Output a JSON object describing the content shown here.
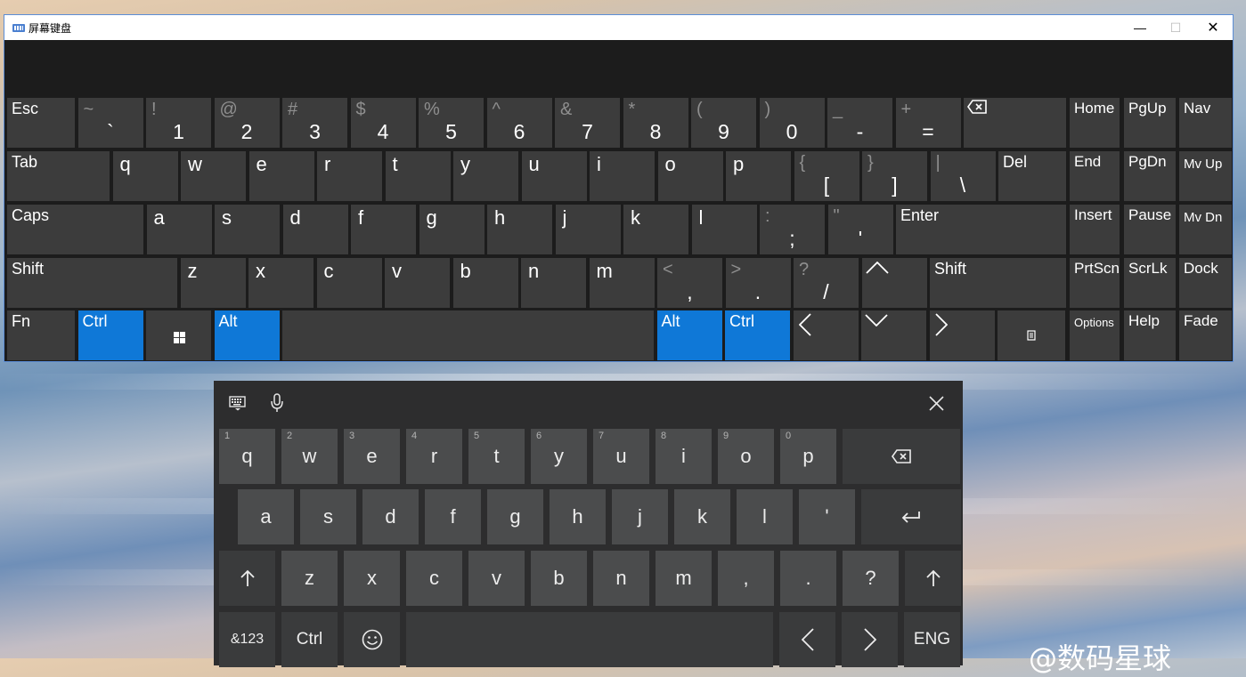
{
  "window": {
    "title": "屏幕键盘"
  },
  "osk": {
    "row1": [
      {
        "label": "Esc"
      },
      {
        "sec": "~",
        "pri": "`"
      },
      {
        "sec": "!",
        "pri": "1"
      },
      {
        "sec": "@",
        "pri": "2"
      },
      {
        "sec": "#",
        "pri": "3"
      },
      {
        "sec": "$",
        "pri": "4"
      },
      {
        "sec": "%",
        "pri": "5"
      },
      {
        "sec": "^",
        "pri": "6"
      },
      {
        "sec": "&",
        "pri": "7"
      },
      {
        "sec": "*",
        "pri": "8"
      },
      {
        "sec": "(",
        "pri": "9"
      },
      {
        "sec": ")",
        "pri": "0"
      },
      {
        "sec": "_",
        "pri": "-"
      },
      {
        "sec": "+",
        "pri": "="
      },
      {
        "icon": "backspace-icon"
      }
    ],
    "row2": [
      {
        "label": "Tab"
      },
      {
        "label": "q"
      },
      {
        "label": "w"
      },
      {
        "label": "e"
      },
      {
        "label": "r"
      },
      {
        "label": "t"
      },
      {
        "label": "y"
      },
      {
        "label": "u"
      },
      {
        "label": "i"
      },
      {
        "label": "o"
      },
      {
        "label": "p"
      },
      {
        "sec": "{",
        "pri": "["
      },
      {
        "sec": "}",
        "pri": "]"
      },
      {
        "sec": "|",
        "pri": "\\"
      },
      {
        "label": "Del"
      }
    ],
    "row3": [
      {
        "label": "Caps"
      },
      {
        "label": "a"
      },
      {
        "label": "s"
      },
      {
        "label": "d"
      },
      {
        "label": "f"
      },
      {
        "label": "g"
      },
      {
        "label": "h"
      },
      {
        "label": "j"
      },
      {
        "label": "k"
      },
      {
        "label": "l"
      },
      {
        "sec": ":",
        "pri": ";"
      },
      {
        "sec": "\"",
        "pri": "'"
      },
      {
        "label": "Enter"
      }
    ],
    "row4": [
      {
        "label": "Shift"
      },
      {
        "label": "z"
      },
      {
        "label": "x"
      },
      {
        "label": "c"
      },
      {
        "label": "v"
      },
      {
        "label": "b"
      },
      {
        "label": "n"
      },
      {
        "label": "m"
      },
      {
        "sec": "<",
        "pri": ","
      },
      {
        "sec": ">",
        "pri": "."
      },
      {
        "sec": "?",
        "pri": "/"
      },
      {
        "icon": "arrow-up-icon"
      },
      {
        "label": "Shift"
      }
    ],
    "row5": [
      {
        "label": "Fn"
      },
      {
        "label": "Ctrl",
        "active": true
      },
      {
        "icon": "windows-icon"
      },
      {
        "label": "Alt",
        "active": true
      },
      {
        "label": ""
      },
      {
        "label": "Alt",
        "active": true
      },
      {
        "label": "Ctrl",
        "active": true
      },
      {
        "icon": "arrow-left-icon"
      },
      {
        "icon": "arrow-down-icon"
      },
      {
        "icon": "arrow-right-icon"
      },
      {
        "icon": "menu-key-icon"
      }
    ],
    "nav": [
      [
        "Home",
        "PgUp",
        "Nav"
      ],
      [
        "End",
        "PgDn",
        "Mv Up"
      ],
      [
        "Insert",
        "Pause",
        "Mv Dn"
      ],
      [
        "PrtScn",
        "ScrLk",
        "Dock"
      ],
      [
        "Options",
        "Help",
        "Fade"
      ]
    ],
    "active_color": "#0f78d7"
  },
  "touch_keyboard": {
    "toolbar": {
      "icons": [
        "keyboard-settings-icon",
        "microphone-icon"
      ],
      "close_icon": "close-icon"
    },
    "row1": [
      {
        "label": "q",
        "num": "1"
      },
      {
        "label": "w",
        "num": "2"
      },
      {
        "label": "e",
        "num": "3"
      },
      {
        "label": "r",
        "num": "4"
      },
      {
        "label": "t",
        "num": "5"
      },
      {
        "label": "y",
        "num": "6"
      },
      {
        "label": "u",
        "num": "7"
      },
      {
        "label": "i",
        "num": "8"
      },
      {
        "label": "o",
        "num": "9"
      },
      {
        "label": "p",
        "num": "0"
      },
      {
        "icon": "backspace-icon"
      }
    ],
    "row2": [
      {
        "label": "a"
      },
      {
        "label": "s"
      },
      {
        "label": "d"
      },
      {
        "label": "f"
      },
      {
        "label": "g"
      },
      {
        "label": "h"
      },
      {
        "label": "j"
      },
      {
        "label": "k"
      },
      {
        "label": "l"
      },
      {
        "label": "'"
      },
      {
        "icon": "enter-icon"
      }
    ],
    "row3": [
      {
        "icon": "shift-icon"
      },
      {
        "label": "z"
      },
      {
        "label": "x"
      },
      {
        "label": "c"
      },
      {
        "label": "v"
      },
      {
        "label": "b"
      },
      {
        "label": "n"
      },
      {
        "label": "m"
      },
      {
        "label": ","
      },
      {
        "label": "."
      },
      {
        "label": "?"
      },
      {
        "icon": "shift-icon"
      }
    ],
    "row4": [
      {
        "label": "&123"
      },
      {
        "label": "Ctrl"
      },
      {
        "icon": "emoji-icon"
      },
      {
        "label": ""
      },
      {
        "icon": "arrow-left-icon"
      },
      {
        "icon": "arrow-right-icon"
      },
      {
        "label": "ENG"
      }
    ]
  },
  "watermark": {
    "text": "@数码星球"
  }
}
